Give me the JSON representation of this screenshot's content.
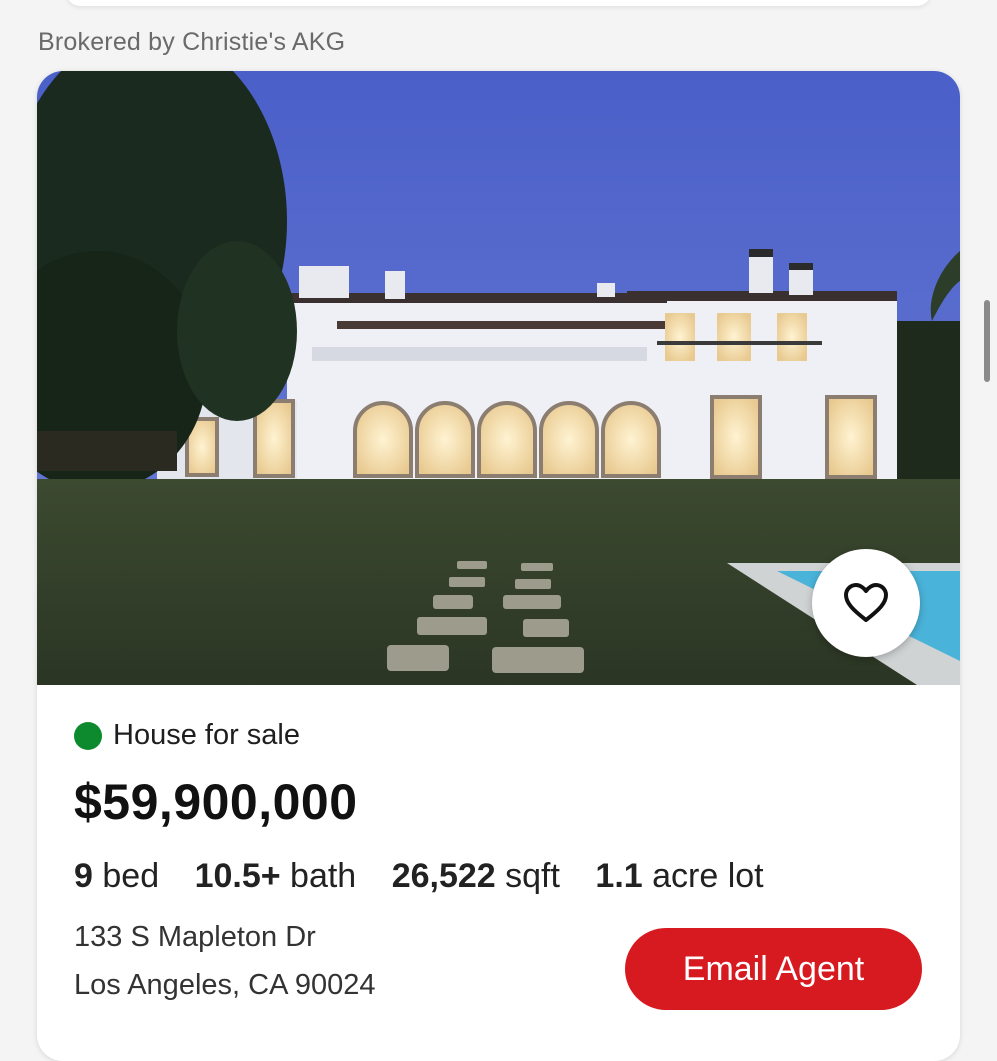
{
  "listing": {
    "broker": "Brokered by Christie's AKG",
    "status": "House for sale",
    "status_color": "#0e8a2e",
    "price": "$59,900,000",
    "specs": {
      "beds_value": "9",
      "beds_unit": "bed",
      "baths_value": "10.5+",
      "baths_unit": "bath",
      "sqft_value": "26,522",
      "sqft_unit": "sqft",
      "lot_value": "1.1",
      "lot_unit": "acre lot"
    },
    "address_line1": "133 S Mapleton Dr",
    "address_line2": "Los Angeles, CA 90024",
    "email_button": "Email Agent",
    "favorite_icon": "heart-outline-icon",
    "accent_color": "#d71920"
  }
}
